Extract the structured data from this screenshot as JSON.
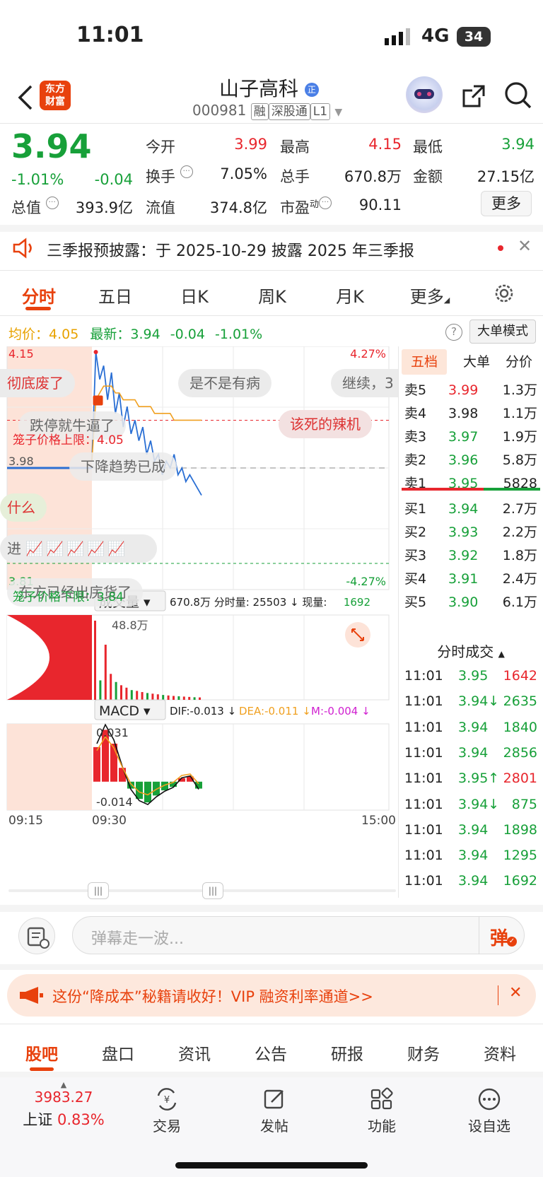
{
  "status": {
    "time": "11:01",
    "network": "4G",
    "battery": "34"
  },
  "header": {
    "title": "山子高科",
    "code": "000981",
    "badges": [
      "融",
      "深股通",
      "L1"
    ],
    "logo_line1": "东方",
    "logo_line2": "财富"
  },
  "quote": {
    "price": "3.94",
    "change_pct": "-1.01%",
    "change": "-0.04",
    "open_label": "今开",
    "open": "3.99",
    "high_label": "最高",
    "high": "4.15",
    "low_label": "最低",
    "low": "3.94",
    "turnover_label": "换手",
    "turnover": "7.05%",
    "volume_label": "总手",
    "volume": "670.8万",
    "amount_label": "金额",
    "amount": "27.15亿",
    "mktcap_label": "总值",
    "mktcap": "393.9亿",
    "float_label": "流值",
    "float": "374.8亿",
    "pe_label": "市盈",
    "pe_sup": "动",
    "pe": "90.11",
    "more": "更多"
  },
  "notice": {
    "text": "三季报预披露：于 2025-10-29 披露 2025 年三季报"
  },
  "tabs": [
    "分时",
    "五日",
    "日K",
    "周K",
    "月K",
    "更多"
  ],
  "chart_head": {
    "avg_label": "均价：",
    "avg": "4.05",
    "last_label": "最新：",
    "last": "3.94",
    "chg": "-0.04",
    "chg_pct": "-1.01%",
    "mode_btn": "大单模式"
  },
  "chart_labels": {
    "top_price": "4.15",
    "top_pct": "4.27%",
    "bottom_price": "3.81",
    "bottom_pct": "-4.27%",
    "ref_price": "3.98",
    "cage_up": "笼子价格上限：4.05",
    "cage_down": "笼子价格下限：3.84",
    "vol_title": "成交量",
    "vol_info": "670.8万 分时量: 25503 ↓ 现量:",
    "vol_now": "1692",
    "vol_max": "48.8万",
    "macd_title": "MACD",
    "dif": "DIF:-0.013 ↓",
    "dea": "DEA:-0.011 ↓",
    "m": "M:-0.004 ↓",
    "macd_top": "0.031",
    "macd_bottom": "-0.014",
    "t_start": "09:15",
    "t_open": "09:30",
    "t_end": "15:00"
  },
  "danmu": [
    "彻底废了",
    "是不是有病",
    "继续，3",
    "跌停就牛逼了",
    "该死的辣机",
    "下降趋势已成",
    "什么",
    "进",
    "东方已经出庑货了"
  ],
  "chart_data": [
    {
      "type": "line",
      "title": "",
      "x": [
        "09:30",
        "09:32",
        "09:34",
        "09:36",
        "09:38",
        "09:40",
        "09:42",
        "09:44",
        "09:46",
        "09:48",
        "09:50",
        "09:52",
        "09:54",
        "09:56",
        "09:58",
        "10:00",
        "10:05",
        "10:10",
        "10:15",
        "10:20",
        "10:25",
        "10:30",
        "10:35",
        "10:40",
        "10:45",
        "10:50",
        "10:55",
        "11:00",
        "11:01"
      ],
      "series": [
        {
          "values": [
            3.99,
            4.15,
            4.11,
            4.13,
            4.08,
            4.12,
            4.06,
            4.09,
            4.04,
            4.07,
            4.03,
            4.05,
            4.02,
            4.04,
            4.0,
            4.02,
            3.99,
            4.0,
            3.97,
            3.99,
            3.98,
            4.0,
            3.97,
            3.98,
            3.96,
            3.97,
            3.96,
            3.95,
            3.94
          ]
        },
        {
          "values": [
            3.99,
            4.08,
            4.09,
            4.1,
            4.1,
            4.1,
            4.09,
            4.09,
            4.08,
            4.08,
            4.08,
            4.08,
            4.07,
            4.07,
            4.07,
            4.07,
            4.06,
            4.06,
            4.06,
            4.06,
            4.06,
            4.05,
            4.05,
            4.05,
            4.05,
            4.05,
            4.05,
            4.05,
            4.05
          ]
        }
      ],
      "ylim": [
        3.81,
        4.15
      ],
      "ref_price": 3.98,
      "cage_upper": 4.05,
      "cage_lower": 3.84
    },
    {
      "type": "bar",
      "title": "成交量",
      "categories": [
        "09:30",
        "09:31",
        "09:32",
        "09:33",
        "09:34",
        "09:35",
        "09:36",
        "09:37",
        "09:38",
        "09:39",
        "09:40",
        "09:45",
        "09:50",
        "09:55",
        "10:00",
        "10:10",
        "10:20",
        "10:30",
        "10:40",
        "10:50",
        "11:00"
      ],
      "values": [
        488000,
        120000,
        340000,
        160000,
        110000,
        90000,
        75000,
        60000,
        55000,
        48000,
        42000,
        38000,
        34000,
        30000,
        27000,
        24000,
        22000,
        20000,
        18000,
        16000,
        15000
      ],
      "ylim": [
        0,
        488000
      ]
    },
    {
      "type": "bar",
      "title": "MACD",
      "categories": [
        "09:30",
        "09:35",
        "09:40",
        "09:45",
        "09:50",
        "09:55",
        "10:00",
        "10:10",
        "10:20",
        "10:30",
        "10:40",
        "10:50",
        "11:00"
      ],
      "values": [
        0.02,
        0.03,
        0.022,
        0.008,
        -0.004,
        -0.01,
        -0.012,
        -0.008,
        -0.005,
        -0.003,
        0.002,
        0.003,
        -0.004
      ],
      "ylim": [
        -0.014,
        0.031
      ]
    }
  ],
  "orderbook": {
    "tabs": [
      "五档",
      "大单",
      "分价"
    ],
    "asks": [
      {
        "label": "卖5",
        "price": "3.99",
        "vol": "1.3万",
        "color": "red"
      },
      {
        "label": "卖4",
        "price": "3.98",
        "vol": "1.1万",
        "color": "dark"
      },
      {
        "label": "卖3",
        "price": "3.97",
        "vol": "1.9万",
        "color": "green"
      },
      {
        "label": "卖2",
        "price": "3.96",
        "vol": "5.8万",
        "color": "green"
      },
      {
        "label": "卖1",
        "price": "3.95",
        "vol": "5828",
        "color": "green"
      }
    ],
    "bids": [
      {
        "label": "买1",
        "price": "3.94",
        "vol": "2.7万",
        "color": "green"
      },
      {
        "label": "买2",
        "price": "3.93",
        "vol": "2.2万",
        "color": "green"
      },
      {
        "label": "买3",
        "price": "3.92",
        "vol": "1.8万",
        "color": "green"
      },
      {
        "label": "买4",
        "price": "3.91",
        "vol": "2.4万",
        "color": "green"
      },
      {
        "label": "买5",
        "price": "3.90",
        "vol": "6.1万",
        "color": "green"
      }
    ],
    "trades_title": "分时成交",
    "trades": [
      {
        "time": "11:01",
        "price": "3.95",
        "vol": "1642",
        "pc": "green",
        "vc": "red"
      },
      {
        "time": "11:01",
        "price": "3.94↓",
        "vol": "2635",
        "pc": "green",
        "vc": "green"
      },
      {
        "time": "11:01",
        "price": "3.94",
        "vol": "1840",
        "pc": "green",
        "vc": "green"
      },
      {
        "time": "11:01",
        "price": "3.94",
        "vol": "2856",
        "pc": "green",
        "vc": "green"
      },
      {
        "time": "11:01",
        "price": "3.95↑",
        "vol": "2801",
        "pc": "green",
        "vc": "red"
      },
      {
        "time": "11:01",
        "price": "3.94↓",
        "vol": "875",
        "pc": "green",
        "vc": "green"
      },
      {
        "time": "11:01",
        "price": "3.94",
        "vol": "1898",
        "pc": "green",
        "vc": "green"
      },
      {
        "time": "11:01",
        "price": "3.94",
        "vol": "1295",
        "pc": "green",
        "vc": "green"
      },
      {
        "time": "11:01",
        "price": "3.94",
        "vol": "1692",
        "pc": "green",
        "vc": "green"
      }
    ]
  },
  "comment": {
    "placeholder": "弹幕走一波...",
    "send_icon": "弹"
  },
  "promo": {
    "text": "这份“降成本”秘籍请收好！VIP 融资利率通道>>"
  },
  "bottom_tabs": [
    "股吧",
    "盘口",
    "资讯",
    "公告",
    "研报",
    "财务",
    "资料"
  ],
  "dock": {
    "index_value": "3983.27",
    "index_name": "上证",
    "index_pct": "0.83%",
    "items": [
      "交易",
      "发帖",
      "功能",
      "设自选"
    ]
  },
  "colors": {
    "up": "#e8262d",
    "down": "#17a039",
    "accent": "#e8410d"
  }
}
